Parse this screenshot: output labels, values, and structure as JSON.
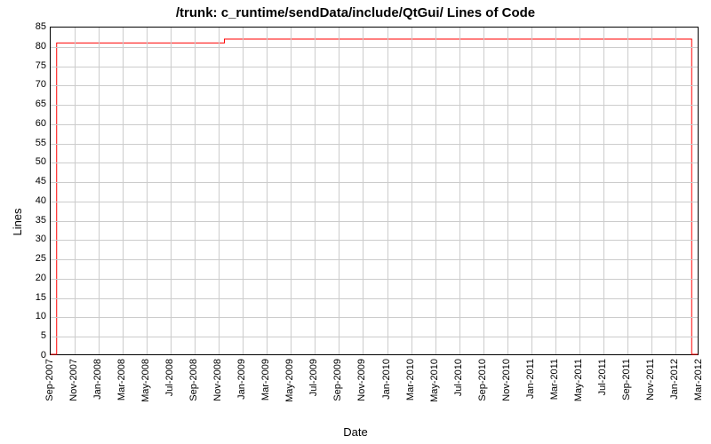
{
  "chart_data": {
    "type": "line",
    "title": "/trunk: c_runtime/sendData/include/QtGui/ Lines of Code",
    "xlabel": "Date",
    "ylabel": "Lines",
    "ylim": [
      0,
      85
    ],
    "y_ticks": [
      0,
      5,
      10,
      15,
      20,
      25,
      30,
      35,
      40,
      45,
      50,
      55,
      60,
      65,
      70,
      75,
      80,
      85
    ],
    "x_ticks": [
      "Sep-2007",
      "Nov-2007",
      "Jan-2008",
      "Mar-2008",
      "May-2008",
      "Jul-2008",
      "Sep-2008",
      "Nov-2008",
      "Jan-2009",
      "Mar-2009",
      "May-2009",
      "Jul-2009",
      "Sep-2009",
      "Nov-2009",
      "Jan-2010",
      "Mar-2010",
      "May-2010",
      "Jul-2010",
      "Sep-2010",
      "Nov-2010",
      "Jan-2011",
      "Mar-2011",
      "May-2011",
      "Jul-2011",
      "Sep-2011",
      "Nov-2011",
      "Jan-2012",
      "Mar-2012"
    ],
    "x": [
      0,
      0.5,
      0.5,
      14.5,
      14.5,
      53.5,
      53.5,
      54
    ],
    "values": [
      0,
      0,
      81,
      81,
      82,
      82,
      0,
      0
    ],
    "x_range": [
      0,
      54
    ],
    "annotations": []
  }
}
